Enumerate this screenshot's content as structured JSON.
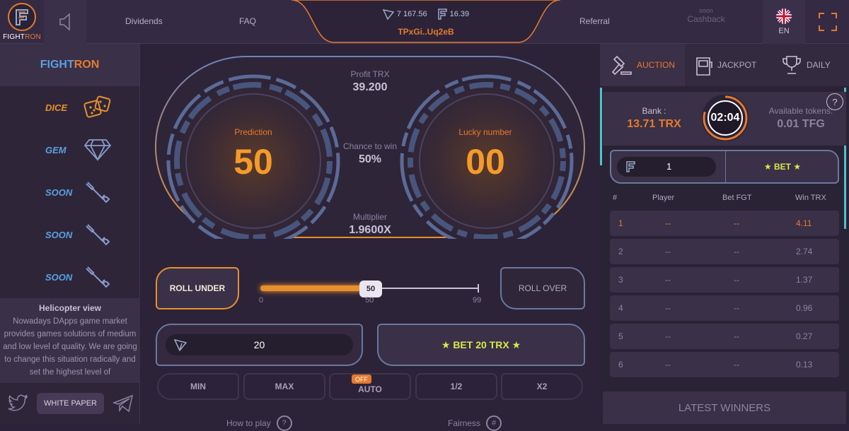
{
  "header": {
    "logo_text_a": "FIGHT",
    "logo_text_b": "RON",
    "nav": {
      "dividends": "Dividends",
      "faq": "FAQ",
      "referral": "Referral"
    },
    "wallet": {
      "trx_balance": "7 167.56",
      "tfg_balance": "16.39",
      "address": "TPxGi..Uq2eB"
    },
    "cashback": {
      "soon": "soon",
      "label": "Cashback"
    },
    "language": "EN"
  },
  "sidebar": {
    "brand_a": "FIGHT",
    "brand_b": "RON",
    "games": [
      {
        "label": "DICE",
        "color": "#e8902e",
        "icon": "dice-icon"
      },
      {
        "label": "GEM",
        "color": "#5aa0e0",
        "icon": "diamond-icon"
      },
      {
        "label": "SOON",
        "color": "#5aa0e0",
        "icon": "wrench-icon"
      },
      {
        "label": "SOON",
        "color": "#5aa0e0",
        "icon": "wrench-icon"
      },
      {
        "label": "SOON",
        "color": "#5aa0e0",
        "icon": "wrench-icon"
      }
    ],
    "helicopter": {
      "title": "Helicopter view",
      "text": "Nowadays DApps game market provides games solutions of medium and low level of quality. We are going to change this situation radically and set the highest level of"
    },
    "white_paper": "WHITE PAPER"
  },
  "game": {
    "prediction_label": "Prediction",
    "prediction_value": "50",
    "lucky_label": "Lucky number",
    "lucky_value": "00",
    "profit_label": "Profit TRX",
    "profit_value": "39.200",
    "chance_label": "Chance to win",
    "chance_value": "50%",
    "multiplier_label": "Multiplier",
    "multiplier_value": "1.9600X",
    "roll_under": "ROLL UNDER",
    "roll_over": "ROLL OVER",
    "slider": {
      "value": "50",
      "min": "0",
      "mid": "50",
      "max": "99",
      "fill_percent": 50
    },
    "bet_amount": "20",
    "bet_button": "★ BET 20 TRX ★",
    "buttons": {
      "min": "MIN",
      "max": "MAX",
      "auto": "AUTO",
      "auto_state": "OFF",
      "half": "1/2",
      "double": "X2"
    },
    "how_to_play": "How to play",
    "fairness": "Fairness",
    "how_to_play_icon": "?",
    "fairness_icon": "#"
  },
  "auction": {
    "tabs": [
      "AUCTION",
      "JACKPOT",
      "DAILY"
    ],
    "bank_label": "Bank :",
    "bank_value": "13.71 TRX",
    "timer": "02:04",
    "available_label": "Available tokens:",
    "available_value": "0.01 TFG",
    "help": "?",
    "bet_amount": "1",
    "bet_button": "★ BET ★",
    "columns": [
      "#",
      "Player",
      "Bet FGT",
      "Win TRX"
    ],
    "rows": [
      {
        "n": "1",
        "player": "--",
        "bet": "--",
        "win": "4.11"
      },
      {
        "n": "2",
        "player": "--",
        "bet": "--",
        "win": "2.74"
      },
      {
        "n": "3",
        "player": "--",
        "bet": "--",
        "win": "1.37"
      },
      {
        "n": "4",
        "player": "--",
        "bet": "--",
        "win": "0.96"
      },
      {
        "n": "5",
        "player": "--",
        "bet": "--",
        "win": "0.27"
      },
      {
        "n": "6",
        "player": "--",
        "bet": "--",
        "win": "0.13"
      }
    ],
    "latest_winners": "LATEST WINNERS"
  },
  "colors": {
    "accent": "#e8902e",
    "blue": "#5aa0e0",
    "bet_text": "#d7e84c",
    "bg": "#2c2338"
  }
}
